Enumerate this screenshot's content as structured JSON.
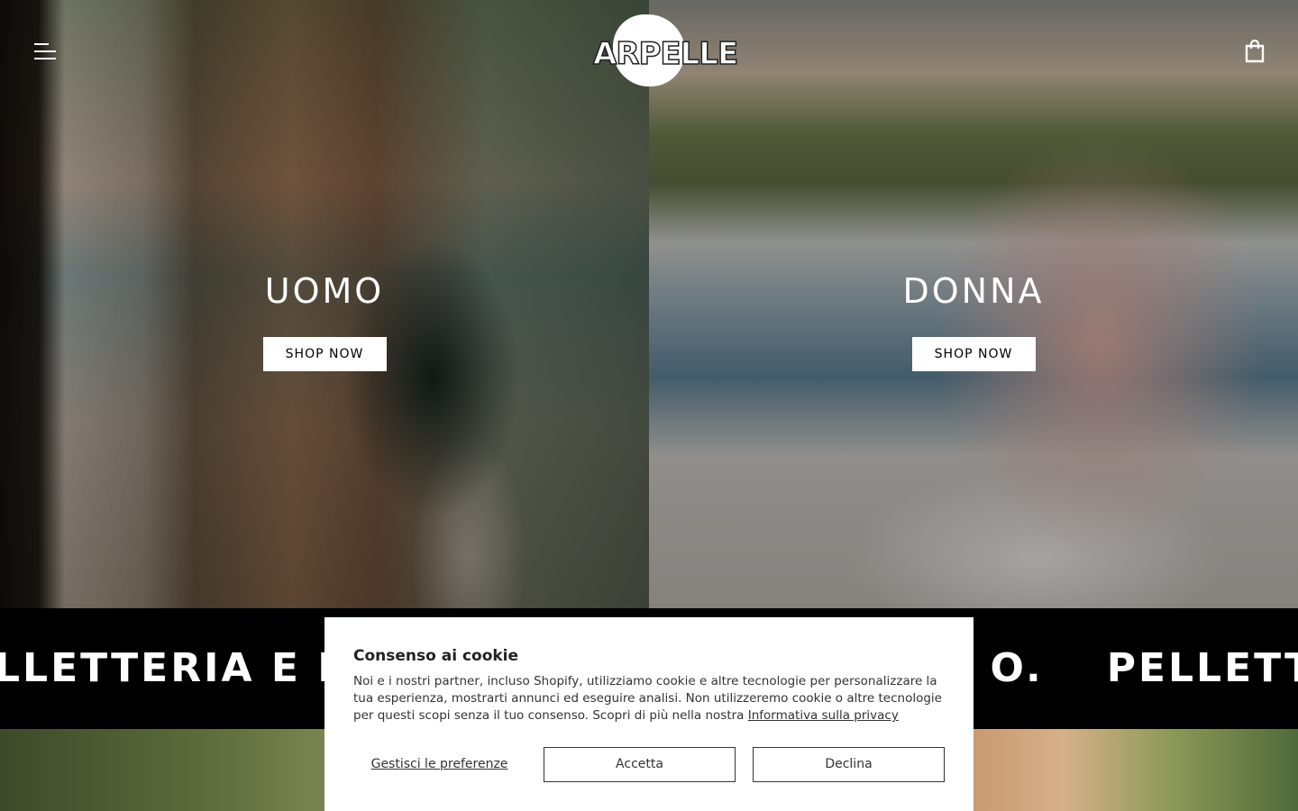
{
  "header": {
    "menu_icon": "hamburger-menu-icon",
    "logo_text": "ARPELLE",
    "cart_icon": "shopping-bag-icon"
  },
  "hero": {
    "men": {
      "title": "UOMO",
      "button": "SHOP NOW"
    },
    "women": {
      "title": "DONNA",
      "button": "SHOP NOW"
    }
  },
  "marquee": {
    "segments": [
      "LLETTERIA E PE",
      "O.",
      "PELLETTER"
    ]
  },
  "cookie": {
    "title": "Consenso ai cookie",
    "body": "Noi e i nostri partner, incluso Shopify, utilizziamo cookie e altre tecnologie per personalizzare la tua esperienza, mostrarti annunci ed eseguire analisi. Non utilizzeremo cookie o altre tecnologie per questi scopi senza il tuo consenso. Scopri di più nella nostra ",
    "privacy_link": "Informativa sulla privacy",
    "manage_button": "Gestisci le preferenze",
    "accept_button": "Accetta",
    "decline_button": "Declina"
  },
  "colors": {
    "overlay_text": "#ffffff",
    "marquee_bg": "#000000",
    "dialog_bg": "#ffffff"
  }
}
